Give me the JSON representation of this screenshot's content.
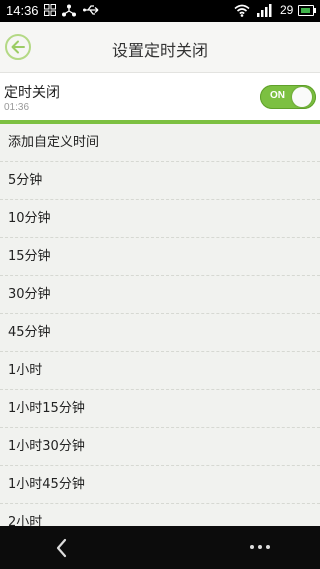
{
  "status_bar": {
    "time": "14:36",
    "battery_pct": "29",
    "icons": [
      "grid-icon",
      "share-icon",
      "usb-icon",
      "wifi-icon",
      "signal-icon",
      "battery-icon"
    ]
  },
  "title_bar": {
    "title": "设置定时关闭",
    "back_icon": "back-arrow-icon"
  },
  "timer": {
    "label": "定时关闭",
    "value": "01:36",
    "toggle_text": "ON",
    "toggle_state": true
  },
  "options": [
    {
      "label": "添加自定义时间"
    },
    {
      "label": "5分钟"
    },
    {
      "label": "10分钟"
    },
    {
      "label": "15分钟"
    },
    {
      "label": "30分钟"
    },
    {
      "label": "45分钟"
    },
    {
      "label": "1小时"
    },
    {
      "label": "1小时15分钟"
    },
    {
      "label": "1小时30分钟"
    },
    {
      "label": "1小时45分钟"
    },
    {
      "label": "2小时"
    }
  ],
  "colors": {
    "accent": "#7cc041",
    "background": "#f1f2ef",
    "status_bar": "#000000"
  }
}
